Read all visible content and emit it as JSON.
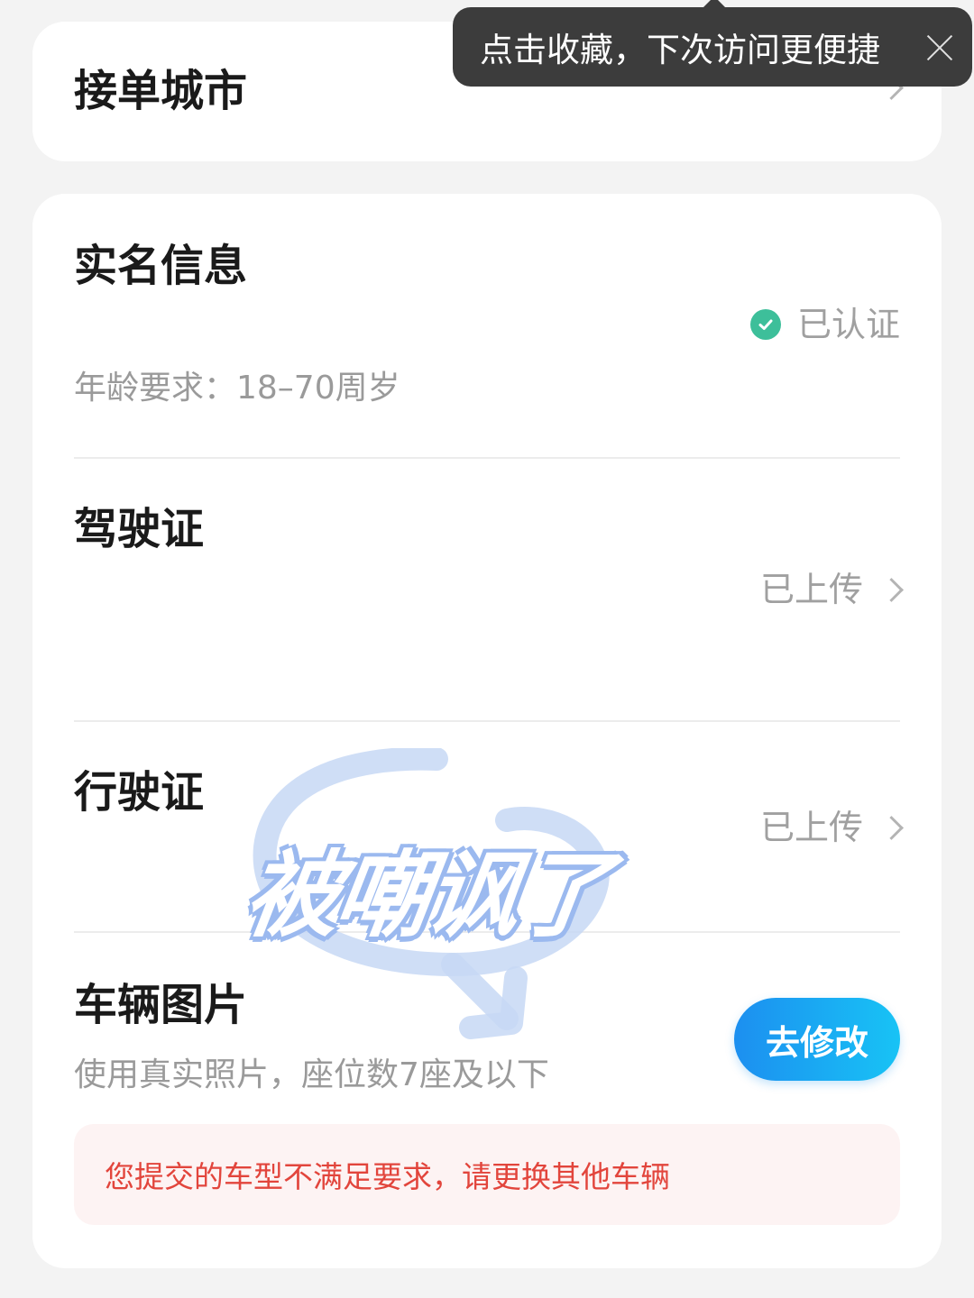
{
  "city_card": {
    "title": "接单城市"
  },
  "tooltip": {
    "text": "点击收藏，下次访问更便捷"
  },
  "real_name": {
    "title": "实名信息",
    "status": "已认证",
    "age_requirement": "年龄要求：18–70周岁"
  },
  "driver_license": {
    "title": "驾驶证",
    "status": "已上传"
  },
  "vehicle_license": {
    "title": "行驶证",
    "status": "已上传"
  },
  "vehicle_photos": {
    "title": "车辆图片",
    "hint": "使用真实照片，座位数7座及以下",
    "button_label": "去修改",
    "error_message": "您提交的车型不满足要求，请更换其他车辆"
  },
  "sticker": {
    "text": "被嘲讽了"
  },
  "colors": {
    "accent_blue": "#1c8ff0",
    "verified_green": "#3dbf9a",
    "error_red": "#e2453c"
  }
}
